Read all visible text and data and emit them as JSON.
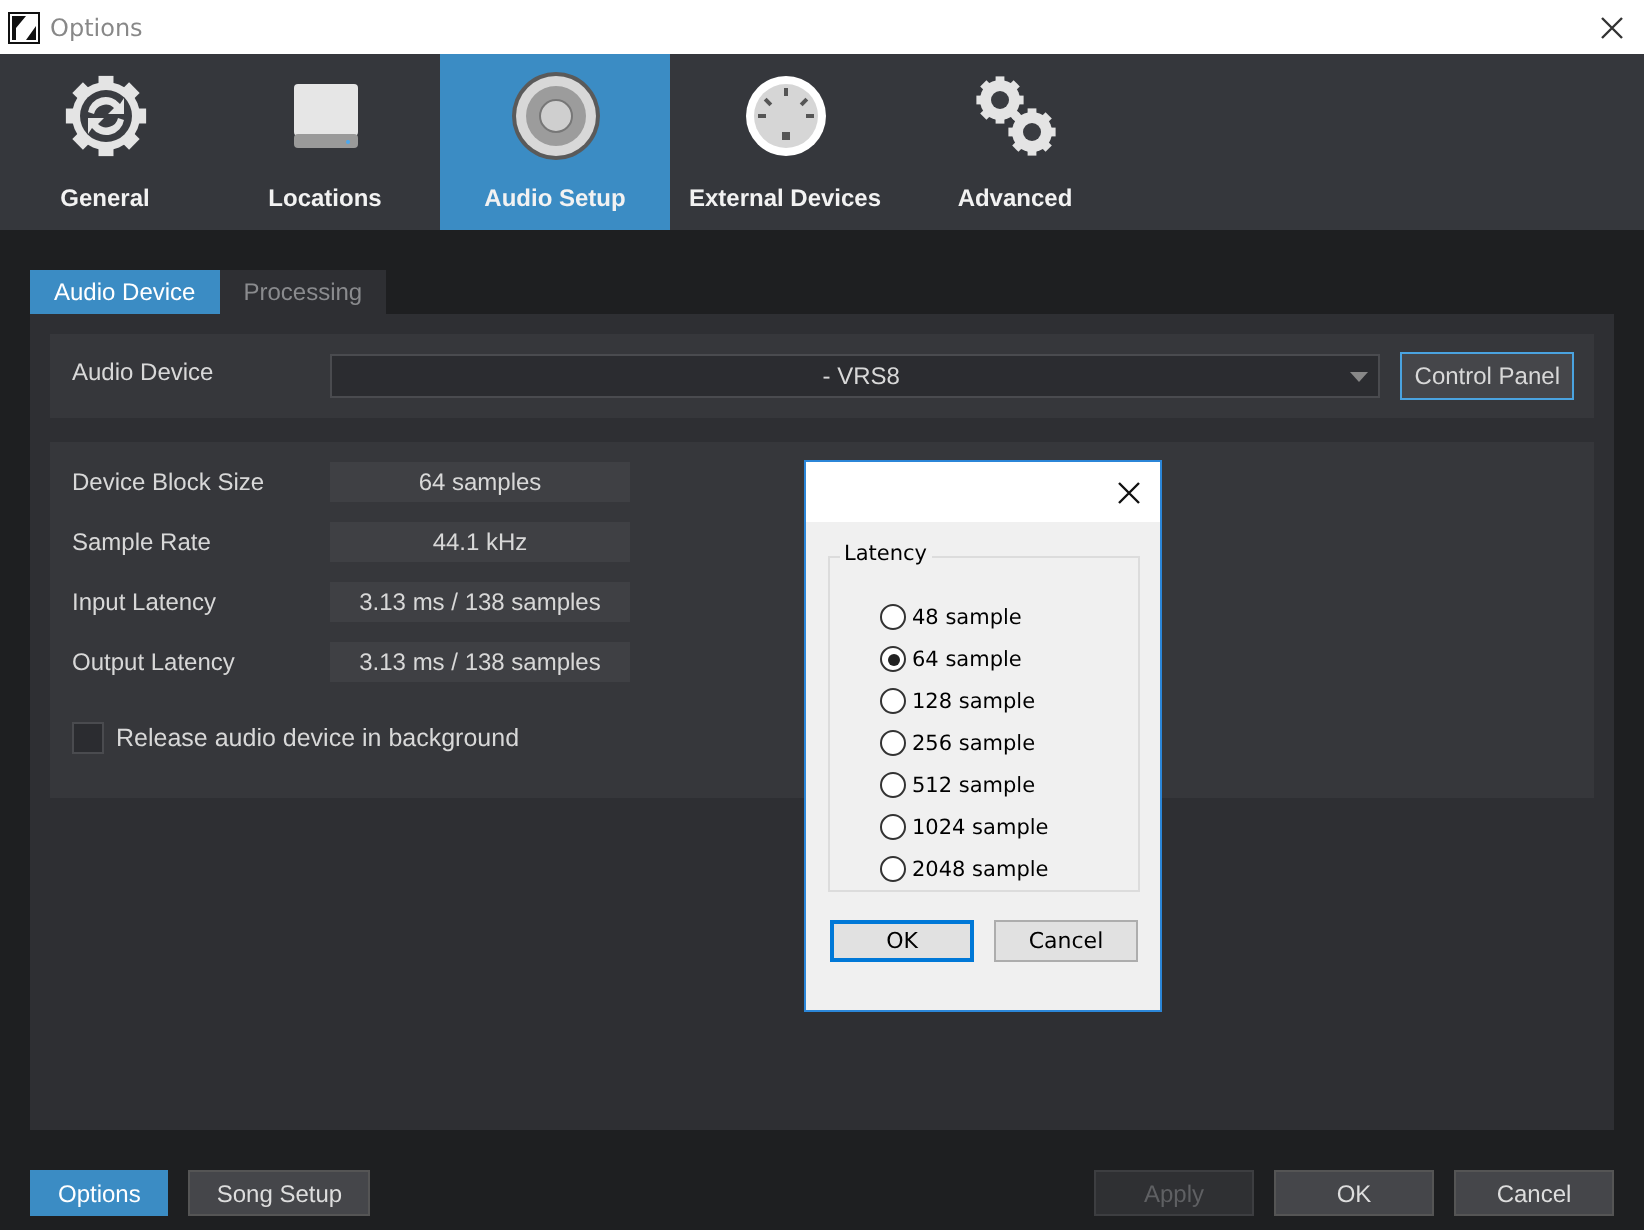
{
  "window": {
    "title": "Options"
  },
  "nav_tabs": [
    {
      "label": "General",
      "kind": "sync-gear",
      "selected": false
    },
    {
      "label": "Locations",
      "kind": "drive",
      "selected": false
    },
    {
      "label": "Audio Setup",
      "kind": "speaker",
      "selected": true
    },
    {
      "label": "External Devices",
      "kind": "din",
      "selected": false
    },
    {
      "label": "Advanced",
      "kind": "gears",
      "selected": false
    }
  ],
  "sub_tabs": [
    {
      "label": "Audio Device",
      "selected": true
    },
    {
      "label": "Processing",
      "selected": false
    }
  ],
  "audio_device": {
    "label": "Audio Device",
    "value": "- VRS8",
    "button": "Control Panel"
  },
  "fields": [
    {
      "label": "Device Block Size",
      "value": "64 samples"
    },
    {
      "label": "Sample Rate",
      "value": "44.1 kHz"
    },
    {
      "label": "Input Latency",
      "value": "3.13 ms / 138 samples"
    },
    {
      "label": "Output Latency",
      "value": "3.13 ms / 138 samples"
    }
  ],
  "release_checkbox": {
    "label": "Release audio device in background",
    "checked": false
  },
  "bottom_left": [
    {
      "label": "Options",
      "selected": true
    },
    {
      "label": "Song Setup",
      "selected": false
    }
  ],
  "bottom_right": [
    {
      "label": "Apply",
      "disabled": true
    },
    {
      "label": "OK",
      "disabled": false
    },
    {
      "label": "Cancel",
      "disabled": false
    }
  ],
  "dialog": {
    "group": "Latency",
    "options": [
      {
        "label": "48 sample",
        "selected": false
      },
      {
        "label": "64 sample",
        "selected": true
      },
      {
        "label": "128 sample",
        "selected": false
      },
      {
        "label": "256 sample",
        "selected": false
      },
      {
        "label": "512 sample",
        "selected": false
      },
      {
        "label": "1024 sample",
        "selected": false
      },
      {
        "label": "2048 sample",
        "selected": false
      }
    ],
    "buttons": [
      {
        "label": "OK",
        "default": true
      },
      {
        "label": "Cancel",
        "default": false
      }
    ]
  }
}
